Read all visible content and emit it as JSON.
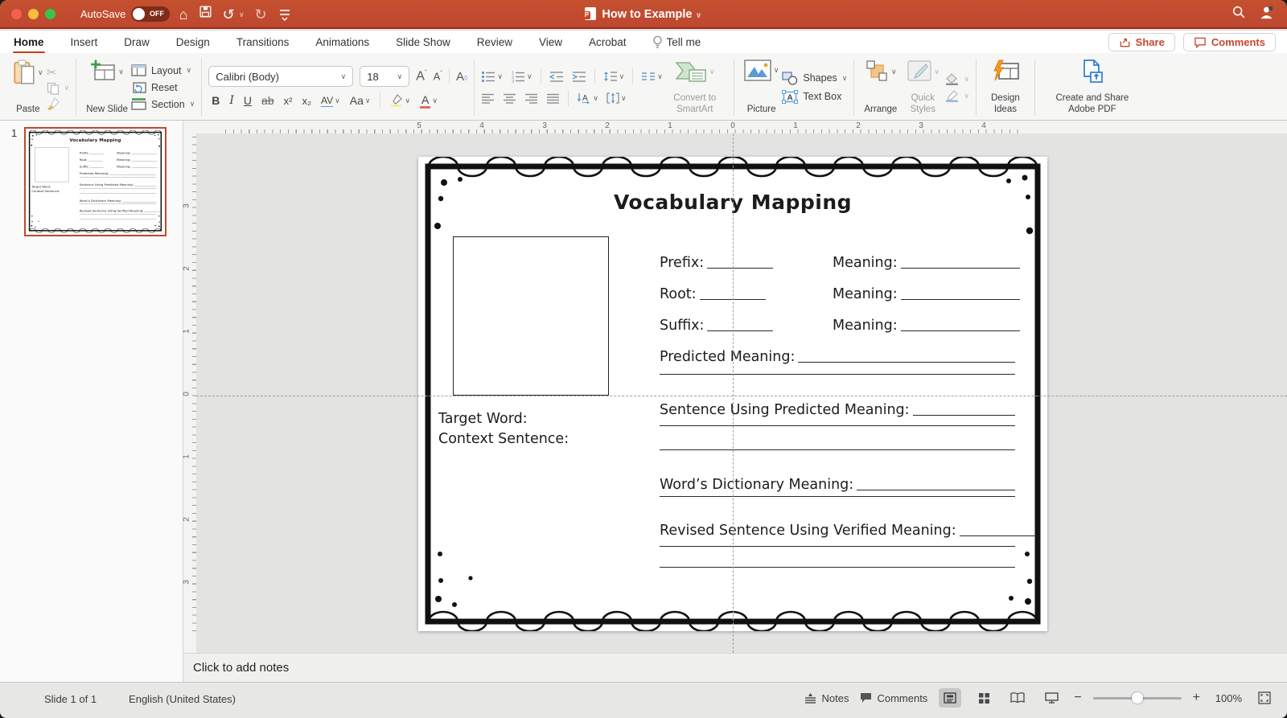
{
  "titlebar": {
    "autosave_label": "AutoSave",
    "autosave_state": "OFF",
    "document_title": "How to Example"
  },
  "tabs": {
    "items": [
      {
        "label": "Home",
        "active": true
      },
      {
        "label": "Insert"
      },
      {
        "label": "Draw"
      },
      {
        "label": "Design"
      },
      {
        "label": "Transitions"
      },
      {
        "label": "Animations"
      },
      {
        "label": "Slide Show"
      },
      {
        "label": "Review"
      },
      {
        "label": "View"
      },
      {
        "label": "Acrobat"
      }
    ],
    "tell_me": "Tell me",
    "share": "Share",
    "comments": "Comments"
  },
  "ribbon": {
    "paste": "Paste",
    "new_slide": "New Slide",
    "layout": "Layout",
    "reset": "Reset",
    "section": "Section",
    "font_name": "Calibri (Body)",
    "font_size": "18",
    "glyphs": {
      "increase_font": "A",
      "decrease_font": "A",
      "clear_format": "A",
      "bold": "B",
      "italic": "I",
      "underline": "U",
      "strikethrough": "ab",
      "superscript": "x²",
      "subscript": "x₂",
      "char_spacing": "AV",
      "change_case": "Aa",
      "font_color": "A"
    },
    "convert_smartart": "Convert to SmartArt",
    "picture": "Picture",
    "shapes": "Shapes",
    "text_box": "Text Box",
    "arrange": "Arrange",
    "quick_styles": "Quick Styles",
    "design_ideas": "Design Ideas",
    "adobe_pdf": "Create and Share Adobe PDF"
  },
  "thumbnails": {
    "slide_number": "1"
  },
  "rulers": {
    "horizontal": [
      "5",
      "4",
      "3",
      "2",
      "1",
      "0",
      "1",
      "2",
      "3",
      "4"
    ],
    "vertical": [
      "3",
      "2",
      "1",
      "0",
      "1",
      "2",
      "3"
    ]
  },
  "slide": {
    "title": "Vocabulary Mapping",
    "rows": [
      {
        "label": "Prefix:",
        "meaning": "Meaning:"
      },
      {
        "label": "Root:",
        "meaning": "Meaning:"
      },
      {
        "label": "Suffix:",
        "meaning": "Meaning:"
      }
    ],
    "predicted_meaning_label": "Predicted Meaning:",
    "sentence_predicted_label": "Sentence Using Predicted Meaning:",
    "dictionary_label": "Word’s Dictionary Meaning:",
    "revised_label": "Revised Sentence Using Verified Meaning:",
    "target_word_label": "Target Word:",
    "context_sentence_label": "Context Sentence:"
  },
  "notes": {
    "placeholder": "Click to add notes"
  },
  "statusbar": {
    "slide_info": "Slide 1 of 1",
    "language": "English (United States)",
    "notes_label": "Notes",
    "comments_label": "Comments",
    "zoom_minus": "−",
    "zoom_plus": "+",
    "zoom_level": "100%"
  },
  "colors": {
    "titlebar": "#c04b30",
    "accent_red": "#c43e1c"
  }
}
